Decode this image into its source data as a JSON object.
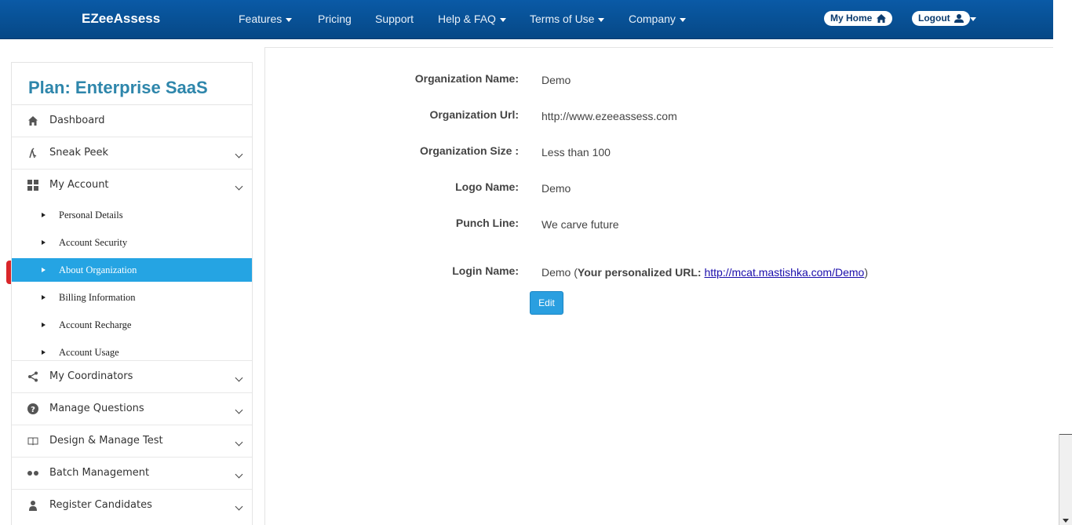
{
  "navbar": {
    "brand": "EZeeAssess",
    "items": [
      {
        "label": "Features",
        "dropdown": true
      },
      {
        "label": "Pricing",
        "dropdown": false
      },
      {
        "label": "Support",
        "dropdown": false
      },
      {
        "label": "Help & FAQ",
        "dropdown": true
      },
      {
        "label": "Terms of Use",
        "dropdown": true
      },
      {
        "label": "Company",
        "dropdown": true
      }
    ],
    "my_home": "My Home",
    "logout": "Logout"
  },
  "sidebar": {
    "plan_title": "Plan: Enterprise SaaS",
    "items": [
      {
        "label": "Dashboard",
        "icon": "home-icon"
      },
      {
        "label": "Sneak Peek",
        "icon": "sneak-peek-icon"
      },
      {
        "label": "My Account",
        "icon": "grid-icon"
      }
    ],
    "sub_items": [
      {
        "label": "Personal Details"
      },
      {
        "label": "Account Security"
      },
      {
        "label": "About Organization",
        "active": true
      },
      {
        "label": "Billing Information"
      },
      {
        "label": "Account Recharge"
      },
      {
        "label": "Account Usage"
      }
    ],
    "items_after": [
      {
        "label": "My Coordinators",
        "icon": "share-icon"
      },
      {
        "label": "Manage Questions",
        "icon": "question-icon"
      },
      {
        "label": "Design & Manage Test",
        "icon": "book-icon"
      },
      {
        "label": "Batch Management",
        "icon": "dots-icon"
      },
      {
        "label": "Register Candidates",
        "icon": "user-icon"
      }
    ]
  },
  "organization": {
    "name_label": "Organization Name:",
    "name_value": "Demo",
    "url_label": "Organization Url:",
    "url_value": "http://www.ezeeassess.com",
    "size_label": "Organization Size :",
    "size_value": "Less than 100",
    "logo_label": "Logo Name:",
    "logo_value": "Demo",
    "punch_label": "Punch Line:",
    "punch_value": "We carve future",
    "login_label": "Login Name:",
    "login_value": "Demo",
    "personalized_prefix": "Your personalized URL:",
    "personalized_url": "http://mcat.mastishka.com/Demo",
    "edit_label": "Edit"
  },
  "colors": {
    "navbar": "#0a5aa6",
    "plan_title": "#2e86ab",
    "active_item": "#25a4e3",
    "active_marker": "#d9262a",
    "edit_button": "#2a9fe0"
  }
}
